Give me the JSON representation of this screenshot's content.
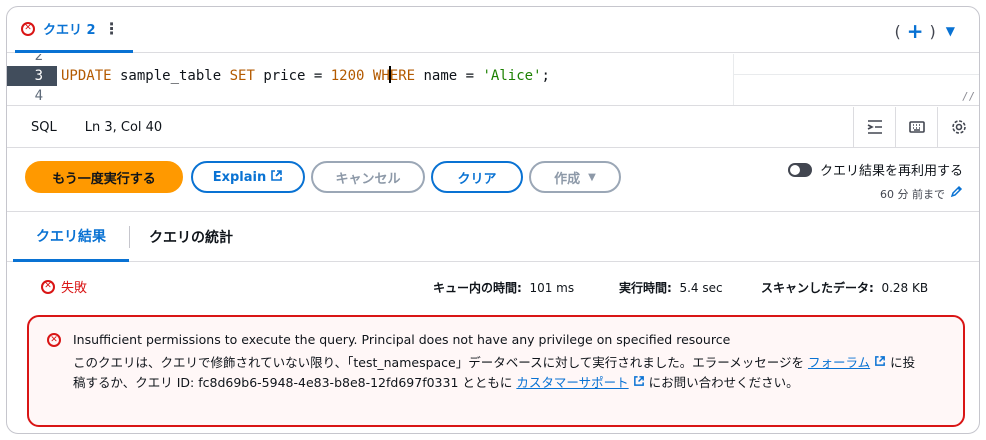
{
  "tab": {
    "label": "クエリ 2",
    "more": "⋮"
  },
  "tab_controls": {
    "open_paren": "(",
    "plus": "+",
    "close_paren": ")",
    "caret": "▼"
  },
  "editor": {
    "line_numbers": [
      "2",
      "3",
      "4"
    ],
    "active_line": "3",
    "code": {
      "k1": "UPDATE",
      "t1": " sample_table ",
      "k2": "SET",
      "t2": " price = ",
      "n1": "1200",
      "t3": " ",
      "k3a": "WH",
      "k3b": "ERE",
      "t4": " name = ",
      "s1": "'Alice'",
      "t5": ";"
    }
  },
  "status": {
    "language": "SQL",
    "position": "Ln 3, Col 40"
  },
  "actions": {
    "run": "もう一度実行する",
    "explain": "Explain",
    "cancel": "キャンセル",
    "clear": "クリア",
    "create": "作成"
  },
  "reuse": {
    "label": "クエリ結果を再利用する",
    "sub": "60 分 前まで"
  },
  "result_tabs": [
    "クエリ結果",
    "クエリの統計"
  ],
  "result": {
    "status": "失敗",
    "queue_label": "キュー内の時間:",
    "queue_value": "101 ms",
    "exec_label": "実行時間:",
    "exec_value": "5.4 sec",
    "scan_label": "スキャンしたデータ:",
    "scan_value": "0.28 KB"
  },
  "error": {
    "title": "Insufficient permissions to execute the query. Principal does not have any privilege on specified resource",
    "body_1": "このクエリは、クエリで修飾されていない限り、「test_namespace」データベースに対して実行されました。エラーメッセージを ",
    "link_1": "フォーラム",
    "body_2": " に投稿するか、クエリ ID: fc8d69b6-5948-4e83-b8e8-12fd697f0331 とともに ",
    "link_2": "カスタマーサポート",
    "body_3": " にお問い合わせください。"
  },
  "colors": {
    "accent": "#0972d3",
    "run_button": "#ff9900",
    "error": "#d91515",
    "error_bg": "#fff7f7"
  }
}
